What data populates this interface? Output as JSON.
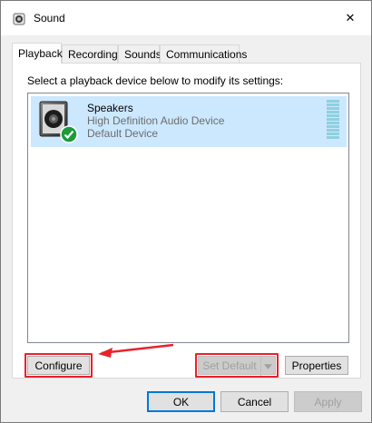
{
  "window": {
    "title": "Sound",
    "close_glyph": "✕"
  },
  "tabs": [
    {
      "label": "Playback",
      "active": true
    },
    {
      "label": "Recording",
      "active": false
    },
    {
      "label": "Sounds",
      "active": false
    },
    {
      "label": "Communications",
      "active": false
    }
  ],
  "playback": {
    "instruction": "Select a playback device below to modify its settings:",
    "devices": [
      {
        "name": "Speakers",
        "driver": "High Definition Audio Device",
        "status": "Default Device",
        "icon": "speaker-icon",
        "badge_icon": "checkmark-icon"
      }
    ]
  },
  "buttons": {
    "configure": "Configure",
    "set_default": "Set Default",
    "set_default_enabled": false,
    "properties": "Properties",
    "ok": "OK",
    "cancel": "Cancel",
    "apply": "Apply",
    "apply_enabled": false
  },
  "annotations": {
    "highlight_color": "#e8222b"
  },
  "colors": {
    "selection": "#cce8ff",
    "level_meter": "#8fd0df",
    "accent": "#0078d7",
    "check_badge": "#1d9a3c"
  }
}
